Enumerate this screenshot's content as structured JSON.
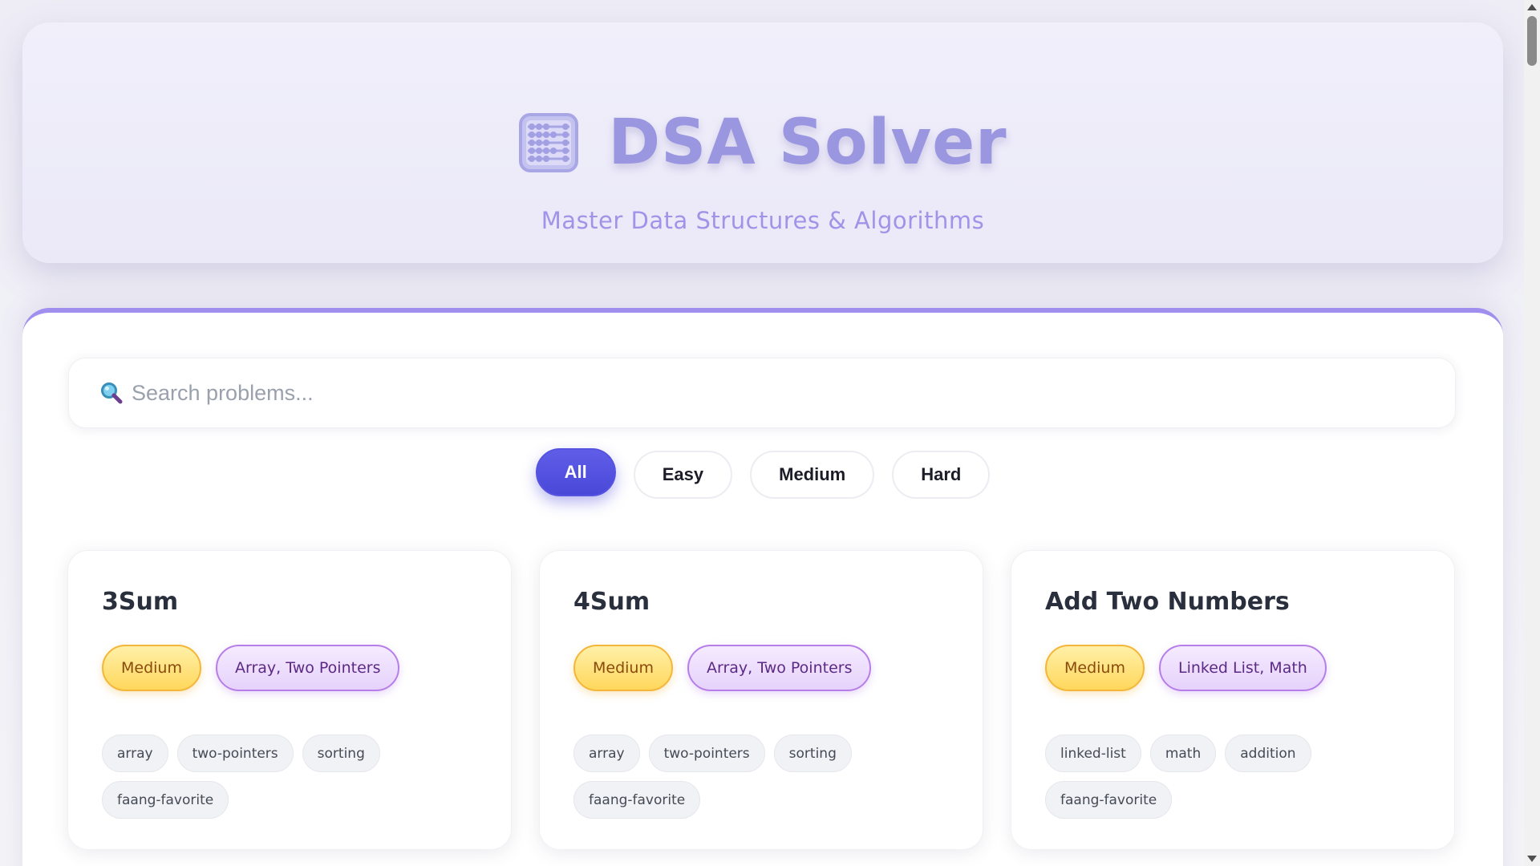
{
  "header": {
    "title": "DSA Solver",
    "subtitle": "Master Data Structures & Algorithms",
    "logo_icon": "abacus-icon"
  },
  "search": {
    "placeholder": "Search problems...",
    "icon": "search-icon"
  },
  "filters": [
    {
      "label": "All",
      "active": true
    },
    {
      "label": "Easy",
      "active": false
    },
    {
      "label": "Medium",
      "active": false
    },
    {
      "label": "Hard",
      "active": false
    }
  ],
  "problems": [
    {
      "title": "3Sum",
      "difficulty": "Medium",
      "category": "Array, Two Pointers",
      "tags": [
        "array",
        "two-pointers",
        "sorting",
        "faang-favorite"
      ]
    },
    {
      "title": "4Sum",
      "difficulty": "Medium",
      "category": "Array, Two Pointers",
      "tags": [
        "array",
        "two-pointers",
        "sorting",
        "faang-favorite"
      ]
    },
    {
      "title": "Add Two Numbers",
      "difficulty": "Medium",
      "category": "Linked List, Math",
      "tags": [
        "linked-list",
        "math",
        "addition",
        "faang-favorite"
      ]
    }
  ],
  "colors": {
    "accent": "#5553e0",
    "panel_border": "#a18ff0",
    "title": "#9a97e0",
    "medium_badge": "#ffd75c",
    "category_badge": "#e6d2fb"
  }
}
